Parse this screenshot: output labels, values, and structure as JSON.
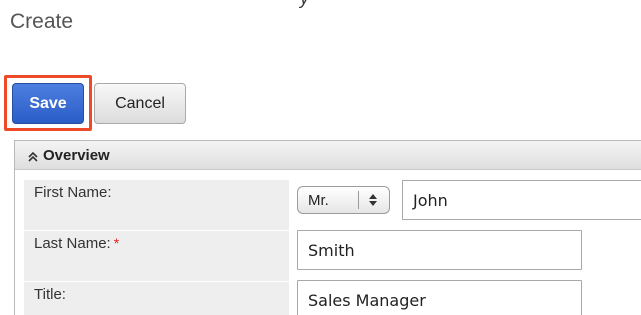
{
  "page": {
    "title": "Create",
    "top_fragment": "y"
  },
  "toolbar": {
    "save_label": "Save",
    "cancel_label": "Cancel"
  },
  "panel": {
    "title": "Overview",
    "collapse_icon": "double-chevron-up-icon"
  },
  "fields": {
    "first_name": {
      "label": "First Name:",
      "salutation": "Mr.",
      "value": "John"
    },
    "last_name": {
      "label": "Last Name:",
      "required_marker": "*",
      "value": "Smith"
    },
    "title": {
      "label": "Title:",
      "value": "Sales Manager"
    }
  },
  "colors": {
    "save_button": "#2f63cc",
    "highlight_border": "#ef4a27",
    "required_marker": "#d62222",
    "label_background": "#eeeeee"
  }
}
